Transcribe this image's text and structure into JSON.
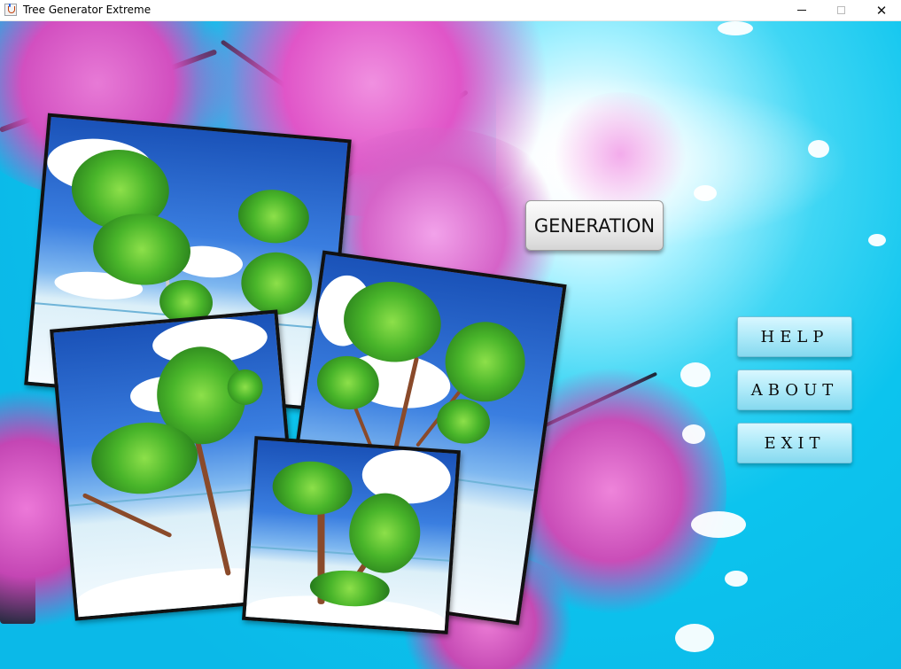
{
  "window": {
    "title": "Tree Generator Extreme",
    "minimize_icon": "minimize-icon",
    "maximize_icon": "maximize-icon",
    "close_icon": "close-icon",
    "close_glyph": "✕"
  },
  "main": {
    "generation_label": "GENERATION",
    "help_label": "HELP",
    "about_label": "ABOUT",
    "exit_label": "EXIT"
  },
  "colors": {
    "sky": "#0cc4ee",
    "blossom": "#e055c8",
    "button_cyan": "#aeeaf9"
  }
}
